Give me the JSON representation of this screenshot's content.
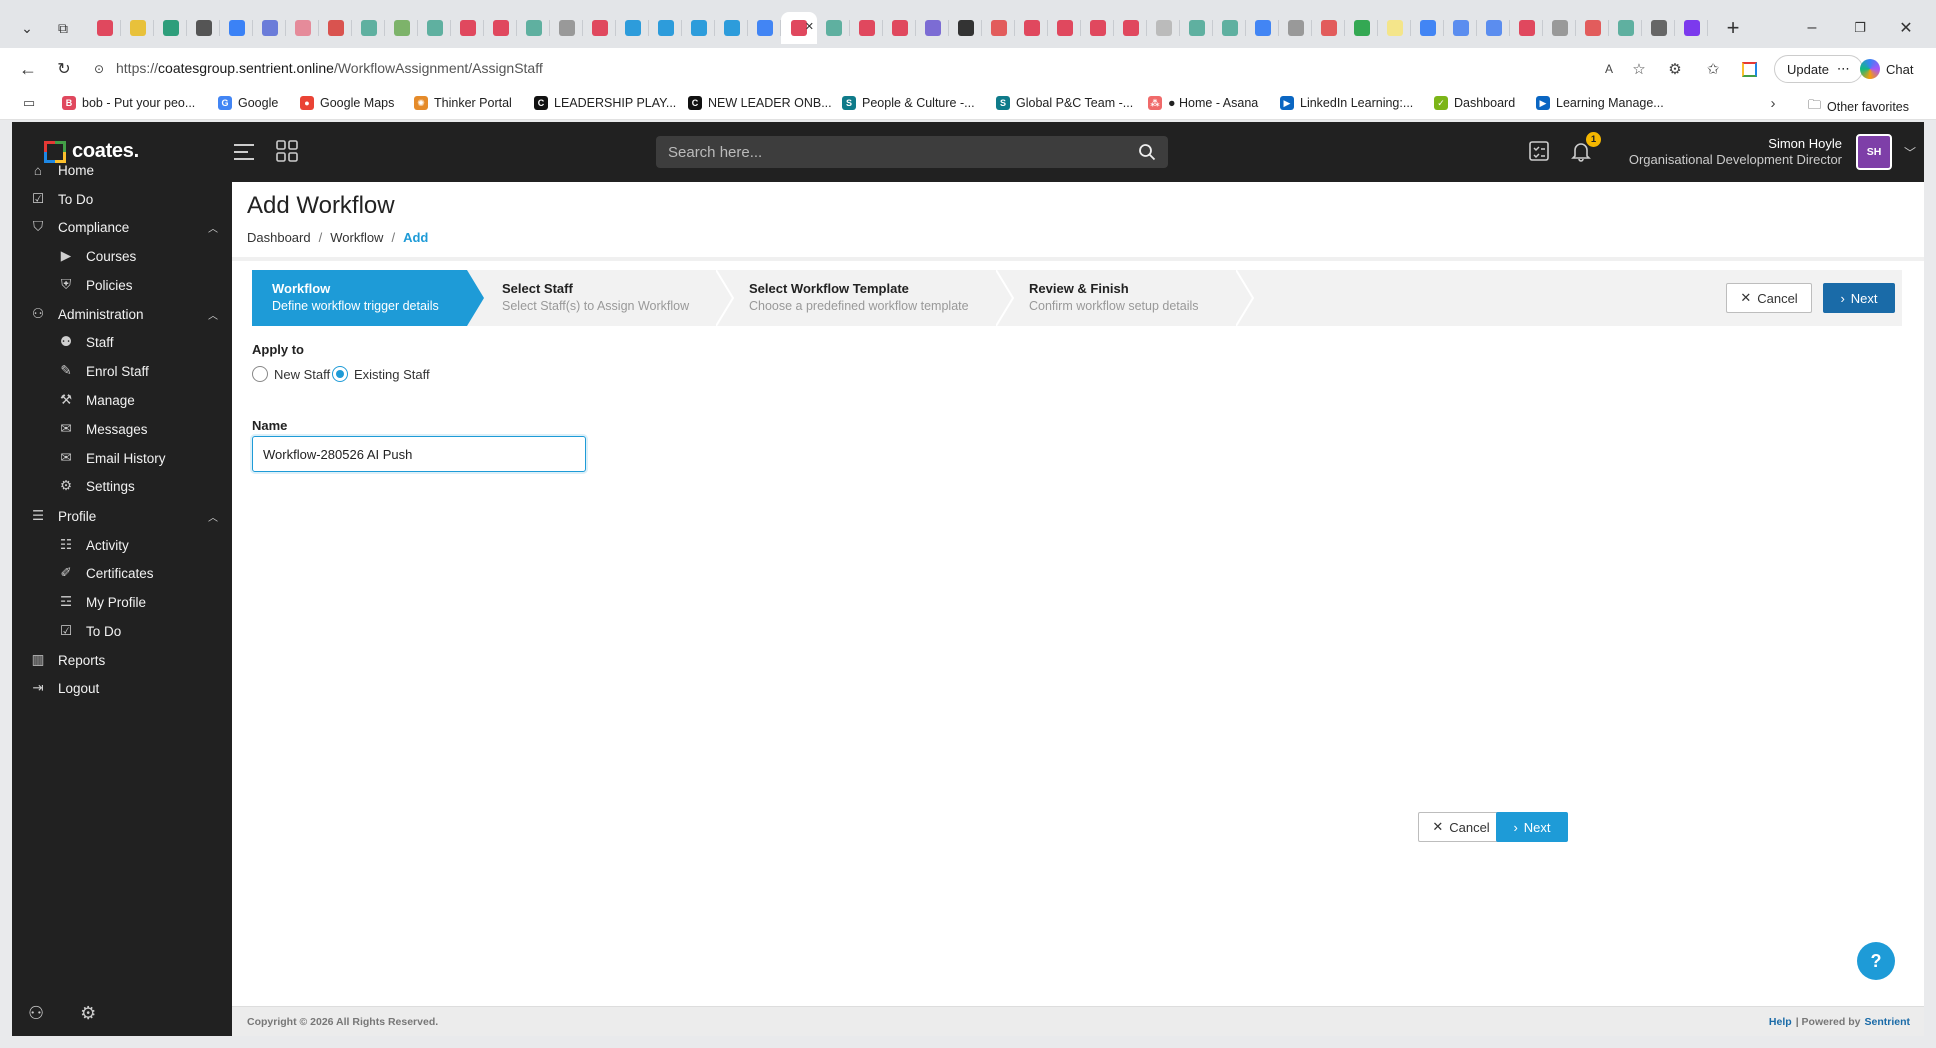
{
  "browser": {
    "url_prefix": "https://",
    "url_host": "coatesgroup.sentrient.online",
    "url_path": "/WorkflowAssignment/AssignStaff",
    "update_label": "Update",
    "chat_label": "Chat",
    "tab_colors": [
      "#e0485e",
      "#e8c13b",
      "#2e9e7b",
      "#555",
      "#3b82f6",
      "#6b7cd9",
      "#e58b9a",
      "#d9534f",
      "#5fb0a0",
      "#7db36a",
      "#5fb0a0",
      "#e0485e",
      "#e0485e",
      "#5fb0a0",
      "#999",
      "#e0485e",
      "#2d9cdb",
      "#2d9cdb",
      "#2d9cdb",
      "#2d9cdb",
      "#4285f4",
      "#e0485e",
      "#5fb0a0",
      "#e0485e",
      "#e0485e",
      "#7c6cd4",
      "#333",
      "#e25c5c",
      "#e0485e",
      "#e0485e",
      "#e0485e",
      "#e0485e",
      "#bbb",
      "#5fb0a0",
      "#5fb0a0",
      "#4285f4",
      "#999",
      "#e25c5c",
      "#34a853",
      "#f4e58a",
      "#4285f4",
      "#5b8def",
      "#5b8def",
      "#e0485e",
      "#999",
      "#e25c5c",
      "#5fb0a0",
      "#666",
      "#7c3aed"
    ],
    "bookmarks": [
      {
        "label": "bob - Put your peo...",
        "icon": "bob-icon",
        "color": "#e0485e",
        "glyph": "B"
      },
      {
        "label": "Google",
        "icon": "google-icon",
        "color": "#4285f4",
        "glyph": "G"
      },
      {
        "label": "Google Maps",
        "icon": "maps-pin-icon",
        "color": "#ea4335",
        "glyph": "●"
      },
      {
        "label": "Thinker Portal",
        "icon": "thinker-icon",
        "color": "#e58b2a",
        "glyph": "✺"
      },
      {
        "label": "LEADERSHIP PLAY...",
        "icon": "c-icon",
        "color": "#111",
        "glyph": "C"
      },
      {
        "label": "NEW LEADER ONB...",
        "icon": "c-icon",
        "color": "#111",
        "glyph": "C"
      },
      {
        "label": "People & Culture -...",
        "icon": "sharepoint-icon",
        "color": "#0f7b8a",
        "glyph": "S"
      },
      {
        "label": "Global P&C Team -...",
        "icon": "sharepoint-icon",
        "color": "#0f7b8a",
        "glyph": "S"
      },
      {
        "label": "● Home - Asana",
        "icon": "asana-icon",
        "color": "#f06a6a",
        "glyph": "⁂"
      },
      {
        "label": "LinkedIn Learning:...",
        "icon": "linkedin-learning-icon",
        "color": "#0a66c2",
        "glyph": "▶"
      },
      {
        "label": "Dashboard",
        "icon": "check-circle-icon",
        "color": "#7cb518",
        "glyph": "✓"
      },
      {
        "label": "Learning Manage...",
        "icon": "lms-icon",
        "color": "#0a66c2",
        "glyph": "▶"
      }
    ],
    "other_favorites": "Other favorites"
  },
  "app": {
    "logo_text": "coates.",
    "search_placeholder": "Search here...",
    "notification_count": "1",
    "user_name": "Simon Hoyle",
    "user_role": "Organisational Development Director",
    "user_initials": "SH",
    "sidebar": {
      "home": "Home",
      "todo": "To Do",
      "compliance": "Compliance",
      "courses": "Courses",
      "policies": "Policies",
      "administration": "Administration",
      "staff": "Staff",
      "enrol_staff": "Enrol Staff",
      "manage": "Manage",
      "messages": "Messages",
      "email_history": "Email History",
      "settings": "Settings",
      "profile": "Profile",
      "activity": "Activity",
      "certificates": "Certificates",
      "my_profile": "My Profile",
      "profile_todo": "To Do",
      "reports": "Reports",
      "logout": "Logout"
    }
  },
  "page": {
    "title": "Add Workflow",
    "breadcrumb": [
      "Dashboard",
      "Workflow",
      "Add"
    ],
    "steps": [
      {
        "title": "Workflow",
        "desc": "Define workflow trigger details"
      },
      {
        "title": "Select Staff",
        "desc": "Select Staff(s) to Assign Workflow"
      },
      {
        "title": "Select Workflow Template",
        "desc": "Choose a predefined workflow template"
      },
      {
        "title": "Review & Finish",
        "desc": "Confirm workflow setup details"
      }
    ],
    "cancel_label": "Cancel",
    "next_label": "Next",
    "apply_to_label": "Apply to",
    "apply_options": [
      "New Staff",
      "Existing Staff"
    ],
    "apply_selected": "Existing Staff",
    "name_label": "Name",
    "name_value": "Workflow-280526 AI Push",
    "help_glyph": "?",
    "footer": {
      "copyright": "Copyright © 2026 All Rights Reserved.",
      "help": "Help",
      "powered_by": "| Powered by",
      "brand": "Sentrient"
    }
  },
  "colors": {
    "accent": "#1e9bd7",
    "sidebar_bg": "#212121",
    "avatar_bg": "#7e3fa8",
    "badge": "#f5b700"
  }
}
